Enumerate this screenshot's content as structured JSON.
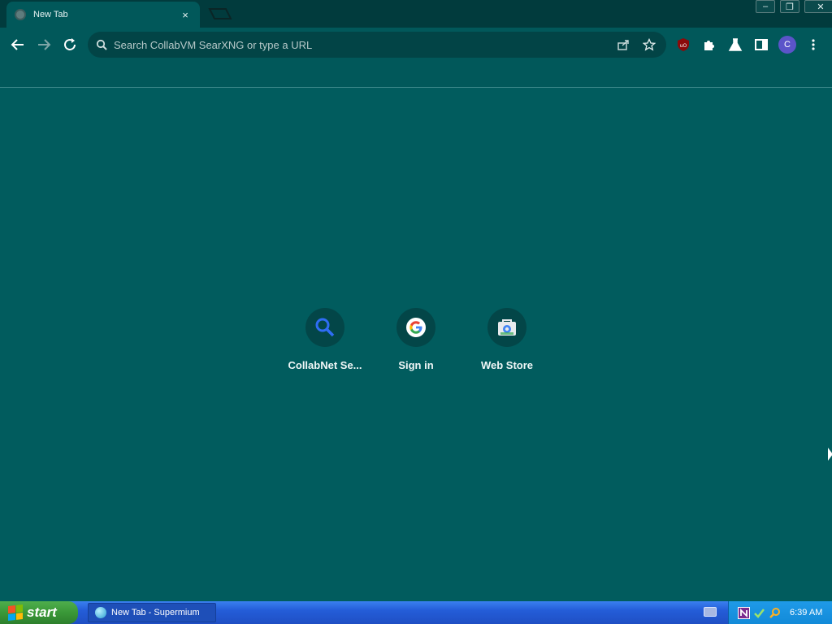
{
  "browser": {
    "tab": {
      "title": "New Tab",
      "close": "×"
    },
    "window_controls": {
      "minimize": "–",
      "restore": "❐",
      "close": "✕"
    },
    "omnibox": {
      "placeholder": "Search CollabVM SearXNG or type a URL"
    },
    "profile_initial": "C",
    "extension_badge": "uO"
  },
  "shortcuts": [
    {
      "label": "CollabNet Se...",
      "icon": "search-icon"
    },
    {
      "label": "Sign in",
      "icon": "google-icon"
    },
    {
      "label": "Web Store",
      "icon": "web-store-icon"
    }
  ],
  "taskbar": {
    "start_label": "start",
    "task_label": "New Tab - Supermium",
    "clock": "6:39 AM"
  },
  "colors": {
    "page_bg": "#015c5e",
    "titlebar_bg": "#013b3d",
    "toolbar_bg": "#01585a",
    "taskbar_blue": "#245dd8",
    "start_green": "#3a9838"
  }
}
